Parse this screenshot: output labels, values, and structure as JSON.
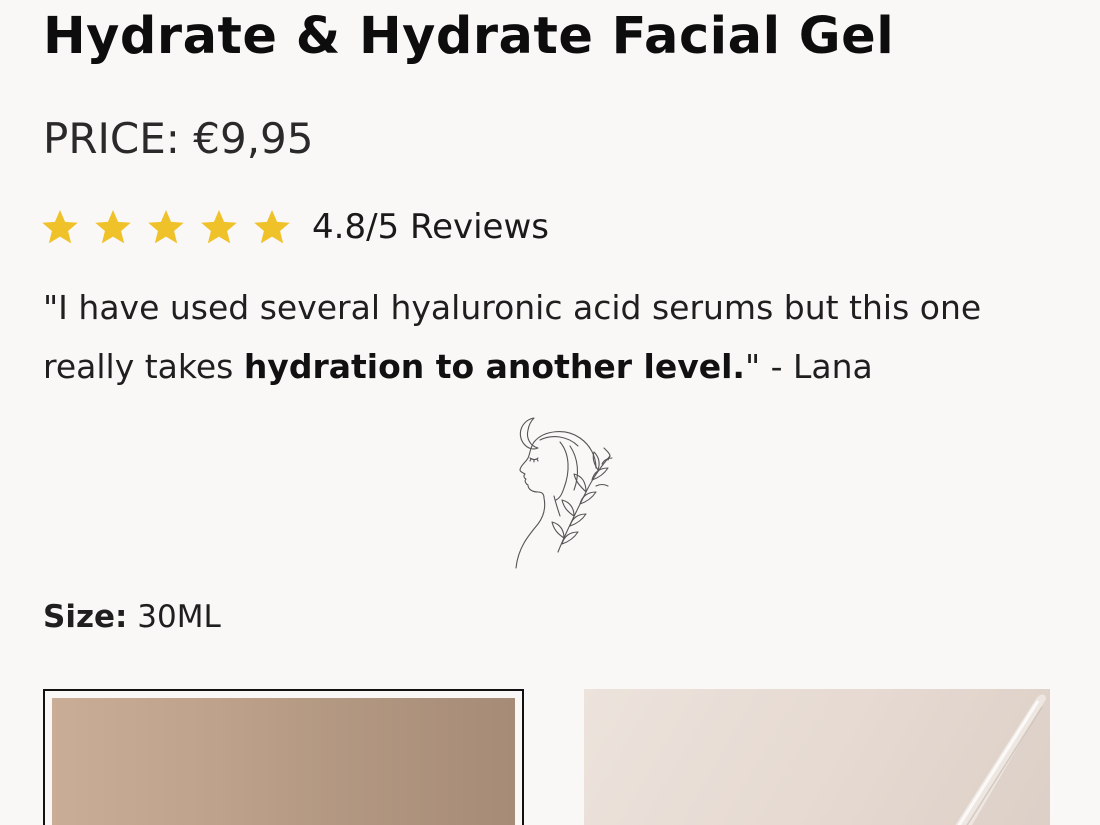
{
  "product": {
    "title": "Hydrate & Hydrate Facial Gel",
    "price": "PRICE: €9,95"
  },
  "rating": {
    "stars": 5,
    "star_color": "#f0c22a",
    "text": "4.8/5 Reviews"
  },
  "review": {
    "quote_start": "\"I have used several hyaluronic acid serums but this one really takes ",
    "quote_bold": "hydration to another level.",
    "quote_end": "\" - Lana"
  },
  "emblem": {
    "icon": "woman-face-moon-leaf-icon"
  },
  "size": {
    "label": "Size:",
    "value": " 30ML"
  },
  "variants": [
    {
      "icon": "product-image-thumbnail",
      "selected": true
    },
    {
      "icon": "product-image-thumbnail",
      "selected": false
    }
  ]
}
